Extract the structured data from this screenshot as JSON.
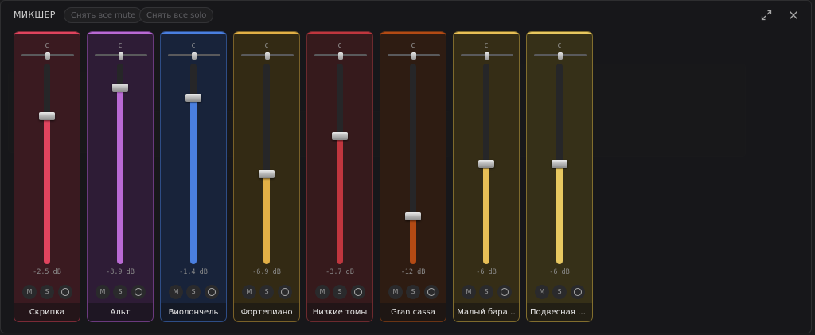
{
  "header": {
    "title": "МИКШЕР",
    "unmute_all_label": "Снять все mute",
    "unsolo_all_label": "Снять все solo",
    "icons": {
      "expand": "expand-icon",
      "close": "close-icon"
    }
  },
  "channel_controls": {
    "mute": "M",
    "solo": "S",
    "record_icon": "record-icon"
  },
  "channels": [
    {
      "name": "Скрипка",
      "pan_label": "C",
      "db_label": "-2.5 dB",
      "level": 0.74,
      "pan": 0.5,
      "color": "#e0445e",
      "bg": "#3a1a20",
      "border": "#7a2a36"
    },
    {
      "name": "Альт",
      "pan_label": "C",
      "db_label": "-8.9 dB",
      "level": 0.88,
      "pan": 0.5,
      "color": "#b96ad4",
      "bg": "#2e1c36",
      "border": "#6a3a7e"
    },
    {
      "name": "Виолончель",
      "pan_label": "C",
      "db_label": "-1.4 dB",
      "level": 0.83,
      "pan": 0.5,
      "color": "#4a7fe0",
      "bg": "#18233a",
      "border": "#2e4d86"
    },
    {
      "name": "Фортепиано",
      "pan_label": "C",
      "db_label": "-6.9 dB",
      "level": 0.45,
      "pan": 0.5,
      "color": "#e3b046",
      "bg": "#332a14",
      "border": "#7a6128"
    },
    {
      "name": "Низкие томы",
      "pan_label": "C",
      "db_label": "-3.7 dB",
      "level": 0.64,
      "pan": 0.5,
      "color": "#c0363e",
      "bg": "#361a1c",
      "border": "#6c2a2e"
    },
    {
      "name": "Gran cassa",
      "pan_label": "C",
      "db_label": "-12 dB",
      "level": 0.24,
      "pan": 0.5,
      "color": "#b34a14",
      "bg": "#2e1c12",
      "border": "#6a3414"
    },
    {
      "name": "Малый бара…",
      "pan_label": "C",
      "db_label": "-6 dB",
      "level": 0.5,
      "pan": 0.5,
      "color": "#e8bf56",
      "bg": "#352d16",
      "border": "#7e6a2c"
    },
    {
      "name": "Подвесная т…",
      "pan_label": "C",
      "db_label": "-6 dB",
      "level": 0.5,
      "pan": 0.5,
      "color": "#e8c860",
      "bg": "#363018",
      "border": "#826e2e"
    }
  ]
}
